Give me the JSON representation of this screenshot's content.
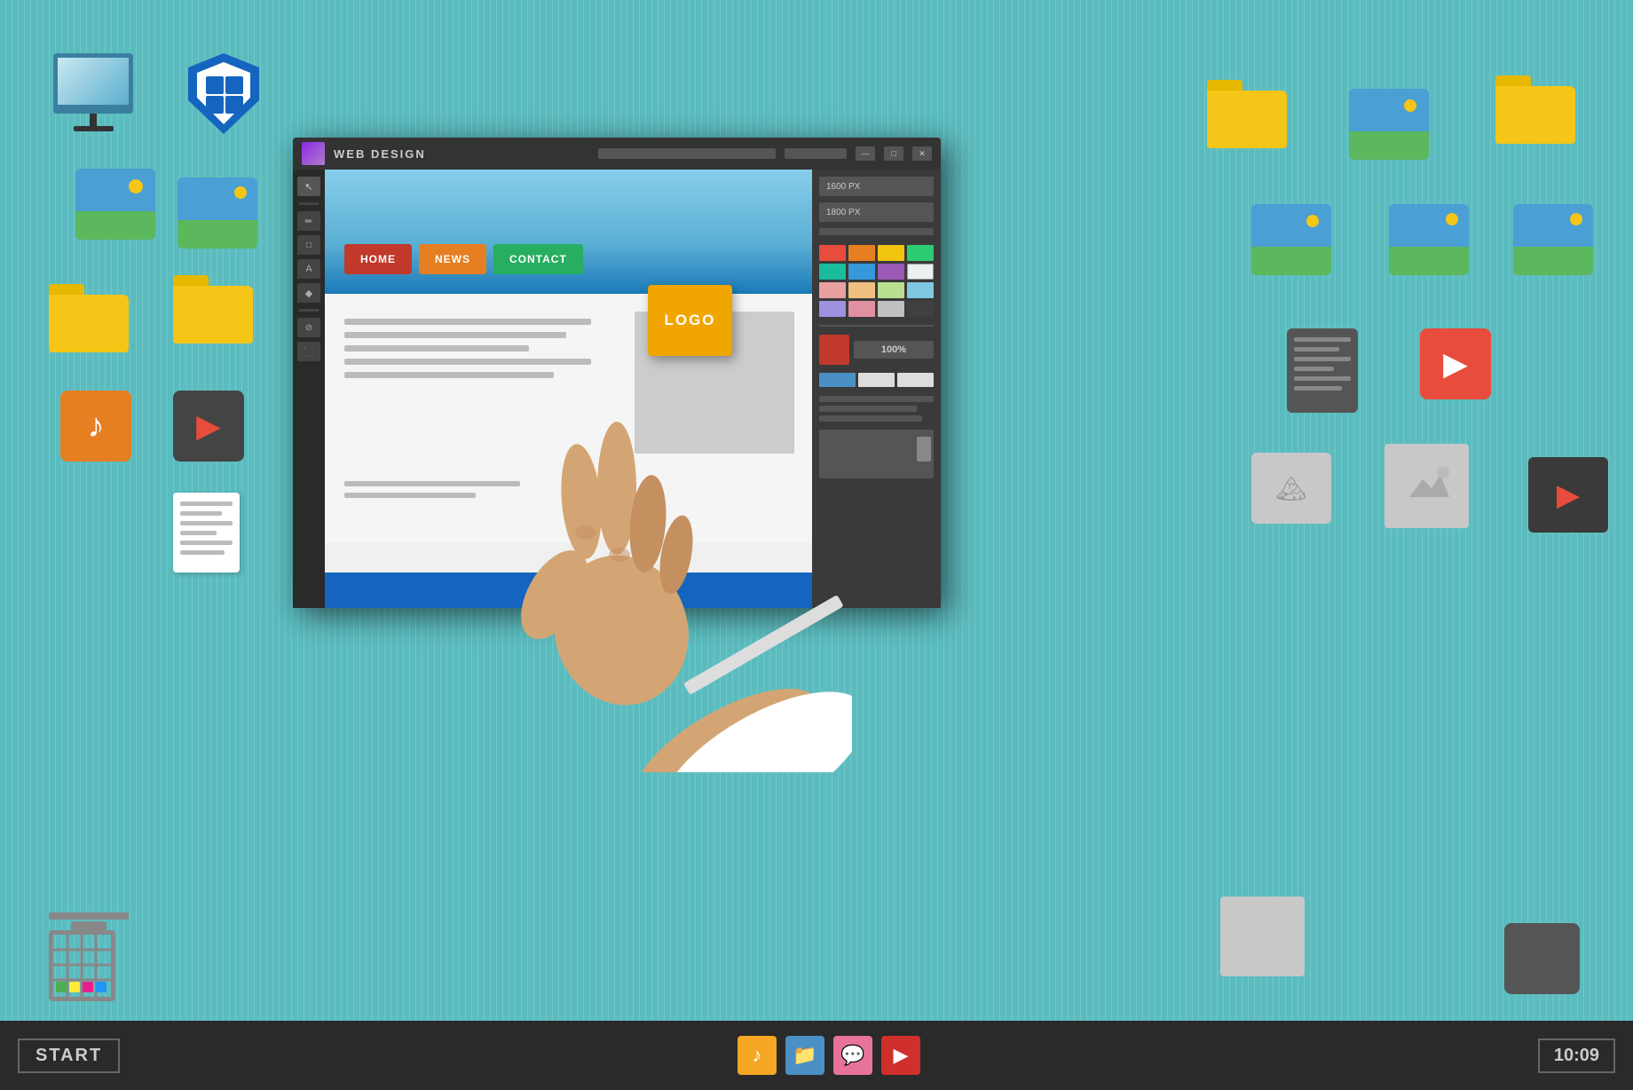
{
  "app": {
    "title": "WEB DESIGN",
    "titlebar": {
      "logo": "purple-stripe",
      "minimize": "—",
      "maximize": "□",
      "close": "✕"
    }
  },
  "taskbar": {
    "start_label": "START",
    "time": "10:09",
    "icons": [
      {
        "name": "music",
        "color": "orange",
        "symbol": "♪"
      },
      {
        "name": "folder",
        "color": "blue",
        "symbol": "📁"
      },
      {
        "name": "chat",
        "color": "pink",
        "symbol": "💬"
      },
      {
        "name": "media",
        "color": "red",
        "symbol": "▶"
      }
    ]
  },
  "web_design_window": {
    "canvas": {
      "nav_buttons": [
        {
          "label": "HOME",
          "color": "#c0392b"
        },
        {
          "label": "NEWS",
          "color": "#e67e22"
        },
        {
          "label": "CONTACT",
          "color": "#27ae60"
        }
      ],
      "logo_sticker": "LOGO"
    },
    "right_panel": {
      "field1": "1600 PX",
      "field2": "1800 PX",
      "zoom": "100%",
      "colors": [
        "#e74c3c",
        "#e67e22",
        "#f1c40f",
        "#2ecc71",
        "#1abc9c",
        "#3498db",
        "#9b59b6",
        "#ecf0f1",
        "#e8a0a0",
        "#f0c080",
        "#b8e090",
        "#80c8e0",
        "#a090e0",
        "#e090a0",
        "#c0c0c0",
        "#404040"
      ]
    }
  },
  "desktop_icons": {
    "monitor": "Monitor",
    "shield": "Windows Shield",
    "photo_1": "Photo",
    "folder_yellow_1": "Folder",
    "folder_yellow_2": "Folder",
    "folder_yellow_3": "Folder",
    "music": "Music",
    "play": "Video",
    "trash": "Recycle Bin",
    "document": "Document",
    "play_red": "Video Red"
  }
}
